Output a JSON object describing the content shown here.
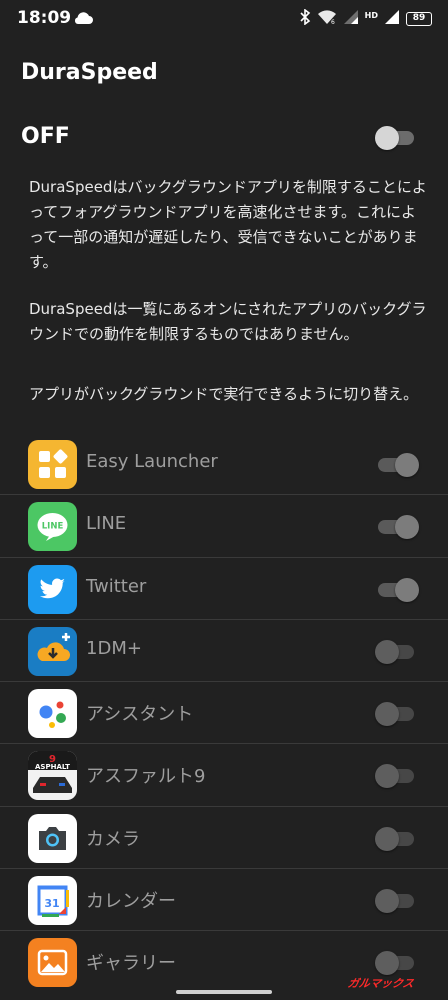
{
  "status_bar": {
    "time": "18:09",
    "network_label": "HD",
    "battery": "89"
  },
  "app_title": "DuraSpeed",
  "master": {
    "label": "OFF",
    "on": false
  },
  "descriptions": [
    "DuraSpeedはバックグラウンドアプリを制限することによってフォアグラウンドアプリを高速化させます。これによって一部の通知が遅延したり、受信できないことがあります。",
    "DuraSpeedは一覧にあるオンにされたアプリのバックグラウンドでの動作を制限するものではありません。",
    "アプリがバックグラウンドで実行できるように切り替え。"
  ],
  "apps": [
    {
      "name": "Easy Launcher",
      "icon": "easy-launcher-icon",
      "enabled": true
    },
    {
      "name": "LINE",
      "icon": "line-icon",
      "enabled": true
    },
    {
      "name": "Twitter",
      "icon": "twitter-icon",
      "enabled": true
    },
    {
      "name": "1DM+",
      "icon": "1dm-icon",
      "enabled": false
    },
    {
      "name": "アシスタント",
      "icon": "assistant-icon",
      "enabled": false
    },
    {
      "name": "アスファルト9",
      "icon": "asphalt9-icon",
      "enabled": false
    },
    {
      "name": "カメラ",
      "icon": "camera-icon",
      "enabled": false
    },
    {
      "name": "カレンダー",
      "icon": "calendar-icon",
      "enabled": false
    },
    {
      "name": "ギャラリー",
      "icon": "gallery-icon",
      "enabled": false
    }
  ],
  "icon_text": {
    "line": "LINE",
    "asphalt_number": "9",
    "asphalt_word": "ASPHALT",
    "calendar_day": "31"
  },
  "watermark": "ガルマックス",
  "colors": {
    "background": "#212121",
    "text_primary": "#ffffff",
    "text_disabled": "#9e9e9e"
  }
}
